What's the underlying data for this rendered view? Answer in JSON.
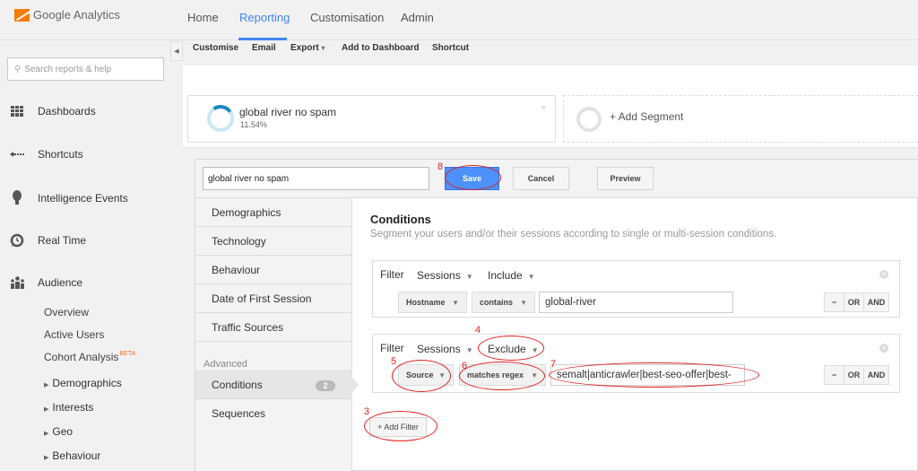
{
  "app": {
    "name": "Google Analytics"
  },
  "top_nav": {
    "tabs": [
      {
        "label": "Home",
        "active": false
      },
      {
        "label": "Reporting",
        "active": true
      },
      {
        "label": "Customisation",
        "active": false
      },
      {
        "label": "Admin",
        "active": false
      }
    ],
    "accent_color": "#4285f4"
  },
  "toolbar": {
    "items": [
      {
        "label": "Customise"
      },
      {
        "label": "Email"
      },
      {
        "label": "Export",
        "dropdown": true
      },
      {
        "label": "Add to Dashboard"
      },
      {
        "label": "Shortcut"
      }
    ],
    "export_caret": "▾"
  },
  "sidebar": {
    "search_placeholder": "Search reports & help",
    "items": [
      {
        "label": "Dashboards",
        "icon": "grid-icon"
      },
      {
        "label": "Shortcuts",
        "icon": "arrow-left-icon"
      },
      {
        "label": "Intelligence Events",
        "icon": "lightbulb-icon"
      },
      {
        "label": "Real Time",
        "icon": "clock-icon"
      },
      {
        "label": "Audience",
        "icon": "people-icon"
      }
    ],
    "audience_sub": [
      {
        "label": "Overview"
      },
      {
        "label": "Active Users"
      },
      {
        "label": "Cohort Analysis",
        "badge": "BETA"
      }
    ],
    "audience_expandable": [
      {
        "label": "Demographics"
      },
      {
        "label": "Interests"
      },
      {
        "label": "Geo"
      },
      {
        "label": "Behaviour"
      }
    ]
  },
  "segments": {
    "active": {
      "name": "global river no spam",
      "percent": "11.54%",
      "percent_value": 11.54
    },
    "add_label": "+ Add Segment"
  },
  "editor": {
    "segment_name_value": "global river no spam",
    "buttons": {
      "save": "Save",
      "cancel": "Cancel",
      "preview": "Preview"
    },
    "menu": [
      {
        "label": "Demographics"
      },
      {
        "label": "Technology"
      },
      {
        "label": "Behaviour"
      },
      {
        "label": "Date of First Session"
      },
      {
        "label": "Traffic Sources"
      }
    ],
    "advanced_label": "Advanced",
    "advanced_menu": [
      {
        "label": "Conditions",
        "count": "2",
        "selected": true
      },
      {
        "label": "Sequences"
      }
    ],
    "conditions": {
      "title": "Conditions",
      "subtitle": "Segment your users and/or their sessions according to single or multi-session conditions.",
      "filters": [
        {
          "filter_label": "Filter",
          "scope": "Sessions",
          "mode": "Include",
          "dimension": "Hostname",
          "operator": "contains",
          "value": "global-river"
        },
        {
          "filter_label": "Filter",
          "scope": "Sessions",
          "mode": "Exclude",
          "dimension": "Source",
          "operator": "matches regex",
          "value": "semalt|anticrawler|best-seo-offer|best-"
        }
      ],
      "row_controls": {
        "remove": "−",
        "or": "OR",
        "and": "AND"
      },
      "add_filter_label": "+ Add Filter"
    }
  },
  "annotations": [
    {
      "number": "3",
      "target": "add-filter"
    },
    {
      "number": "4",
      "target": "exclude-dropdown"
    },
    {
      "number": "5",
      "target": "source-dropdown"
    },
    {
      "number": "6",
      "target": "matches-regex-dropdown"
    },
    {
      "number": "7",
      "target": "regex-value"
    },
    {
      "number": "8",
      "target": "save-button"
    }
  ],
  "annotation_color": "#e02020"
}
